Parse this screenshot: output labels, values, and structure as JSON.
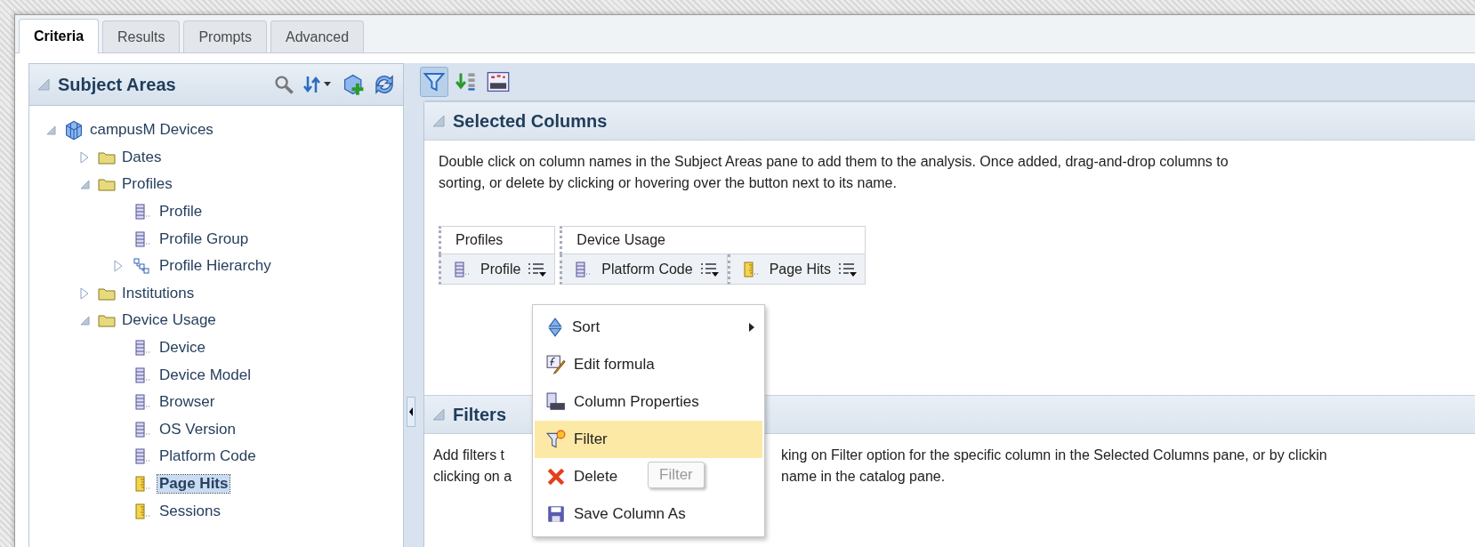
{
  "tabs": [
    {
      "label": "Criteria",
      "selected": true
    },
    {
      "label": "Results",
      "selected": false
    },
    {
      "label": "Prompts",
      "selected": false
    },
    {
      "label": "Advanced",
      "selected": false
    }
  ],
  "subject_areas": {
    "title": "Subject Areas",
    "tree": [
      {
        "label": "campusM Devices",
        "kind": "subject-area",
        "expanded": true,
        "selected": false,
        "children": [
          {
            "label": "Dates",
            "kind": "folder",
            "expanded": false,
            "selected": false
          },
          {
            "label": "Profiles",
            "kind": "folder",
            "expanded": true,
            "selected": false,
            "children": [
              {
                "label": "Profile",
                "kind": "attribute",
                "selected": false
              },
              {
                "label": "Profile Group",
                "kind": "attribute",
                "selected": false
              },
              {
                "label": "Profile Hierarchy",
                "kind": "hierarchy",
                "expanded": false,
                "selected": false
              }
            ]
          },
          {
            "label": "Institutions",
            "kind": "folder",
            "expanded": false,
            "selected": false
          },
          {
            "label": "Device Usage",
            "kind": "folder",
            "expanded": true,
            "selected": false,
            "children": [
              {
                "label": "Device",
                "kind": "attribute",
                "selected": false
              },
              {
                "label": "Device Model",
                "kind": "attribute",
                "selected": false
              },
              {
                "label": "Browser",
                "kind": "attribute",
                "selected": false
              },
              {
                "label": "OS Version",
                "kind": "attribute",
                "selected": false
              },
              {
                "label": "Platform Code",
                "kind": "attribute",
                "selected": false
              },
              {
                "label": "Page Hits",
                "kind": "measure",
                "selected": true
              },
              {
                "label": "Sessions",
                "kind": "measure",
                "selected": false
              }
            ]
          }
        ]
      }
    ]
  },
  "toolbar": [
    {
      "kind": "filter",
      "selected": true
    },
    {
      "kind": "sort",
      "selected": false
    },
    {
      "kind": "properties",
      "selected": false
    }
  ],
  "selected_columns": {
    "title": "Selected Columns",
    "description": [
      "Double click on column names in the Subject Areas pane to add them to the analysis. Once added, drag-and-drop columns to",
      "sorting, or delete by clicking or hovering over the button next to its name."
    ],
    "groups": [
      {
        "label": "Profiles",
        "columns": [
          {
            "label": "Profile",
            "kind": "attribute"
          }
        ]
      },
      {
        "label": "Device Usage",
        "columns": [
          {
            "label": "Platform Code",
            "kind": "attribute"
          },
          {
            "label": "Page Hits",
            "kind": "measure"
          }
        ]
      }
    ]
  },
  "column_menu": [
    {
      "label": "Sort",
      "kind": "sort",
      "submenu": true,
      "selected": false
    },
    {
      "label": "Edit formula",
      "kind": "formula",
      "submenu": false,
      "selected": false
    },
    {
      "label": "Column Properties",
      "kind": "properties",
      "submenu": false,
      "selected": false
    },
    {
      "label": "Filter",
      "kind": "filter",
      "submenu": false,
      "selected": true
    },
    {
      "label": "Delete",
      "kind": "delete",
      "submenu": false,
      "selected": false
    },
    {
      "label": "Save Column As",
      "kind": "save",
      "submenu": false,
      "selected": false
    }
  ],
  "tooltip": "Filter",
  "filters": {
    "title": "Filters",
    "description": [
      {
        "left": "Add filters t",
        "right": "king on Filter option for the specific column in the Selected Columns pane, or by clickin"
      },
      {
        "left": "clicking on a",
        "right": "name in the catalog pane."
      }
    ]
  }
}
